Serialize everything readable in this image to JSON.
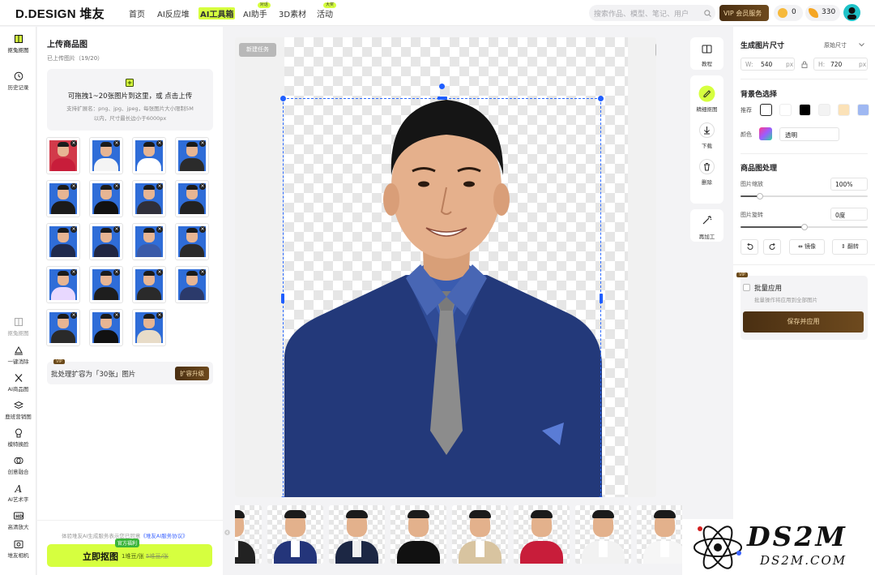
{
  "header": {
    "logo": "D.DESIGN 堆友",
    "nav": [
      {
        "label": "首页",
        "badge": ""
      },
      {
        "label": "AI反应堆",
        "badge": ""
      },
      {
        "label": "AI工具箱",
        "badge": ""
      },
      {
        "label": "AI助手",
        "badge": "对话"
      },
      {
        "label": "3D素材",
        "badge": ""
      },
      {
        "label": "活动",
        "badge": "大奖"
      }
    ],
    "search_placeholder": "搜索作品、模型、笔记、用户",
    "vip_label": "VIP 会员服务",
    "coins": "0",
    "credits": "330"
  },
  "rail": {
    "items": [
      {
        "label": "抠兔抠图",
        "icon": "cutout-icon"
      },
      {
        "label": "历史记录",
        "icon": "history-icon"
      },
      {
        "label": "抠兔抠图",
        "icon": "cutout-icon"
      },
      {
        "label": "一键消除",
        "icon": "eraser-icon"
      },
      {
        "label": "AI商品图",
        "icon": "product-icon"
      },
      {
        "label": "鹿班营销图",
        "icon": "layers-icon"
      },
      {
        "label": "模特换脸",
        "icon": "model-icon"
      },
      {
        "label": "创意融合",
        "icon": "blend-icon"
      },
      {
        "label": "AI艺术字",
        "icon": "art-text-icon"
      },
      {
        "label": "高清放大",
        "icon": "hd-icon"
      },
      {
        "label": "堆友相机",
        "icon": "camera-icon"
      }
    ]
  },
  "upload": {
    "title": "上传商品图",
    "count": "已上传图片（19/20）",
    "dropzone_main": "可拖拽1~20张图片到这里，或 点击上传",
    "dropzone_sub1": "支持扩展名：png、jpg、jpeg，每张图片大小限制5M",
    "dropzone_sub2": "以内，尺寸最长边小于6000px",
    "thumbnail_count": 19,
    "upgrade_text": "批处理扩容为「30张」图片",
    "upgrade_button": "扩容升级",
    "vip_tag": "VIP",
    "agreement_prefix": "体验堆友AI生成服务表示您已同意",
    "agreement_link": "《堆友AI服务协议》",
    "cutout_button": "立即抠图",
    "promo_badge": "官方福利",
    "price_now": "1堆豆/张",
    "price_old": "5堆豆/张"
  },
  "canvas": {
    "new_task": "新建任务"
  },
  "tools": [
    {
      "label": "教程",
      "icon": "book-icon"
    },
    {
      "label": "精细抠图",
      "icon": "refine-icon"
    },
    {
      "label": "下载",
      "icon": "download-icon"
    },
    {
      "label": "删除",
      "icon": "trash-icon"
    },
    {
      "label": "再加工",
      "icon": "magic-icon"
    }
  ],
  "settings": {
    "size_title": "生成图片尺寸",
    "size_preset": "原始尺寸",
    "width_label": "W:",
    "width_value": "540",
    "height_label": "H:",
    "height_value": "720",
    "unit": "px",
    "bg_title": "背景色选择",
    "bg_recommend": "推荐",
    "bg_swatches": [
      "#ffffff",
      "#ffffff",
      "#000000",
      "#f3f3f3",
      "#fbe2b8",
      "#9fb8f2"
    ],
    "bg_color_label": "颜色",
    "bg_color_value": "透明",
    "process_title": "商品图处理",
    "scale_label": "图片缩放",
    "scale_value": "100%",
    "scale_fraction": 0.15,
    "rotate_label": "图片旋转",
    "rotate_value": "0度",
    "rotate_fraction": 0.5,
    "mirror_label": "镜像",
    "flip_label": "翻转",
    "batch_title": "批量应用",
    "batch_desc": "批量操作将应用到全部图片",
    "save_button": "保存并应用"
  },
  "strip_count": 8,
  "watermark": {
    "title": "DS2M",
    "site": "DS2M.COM"
  }
}
